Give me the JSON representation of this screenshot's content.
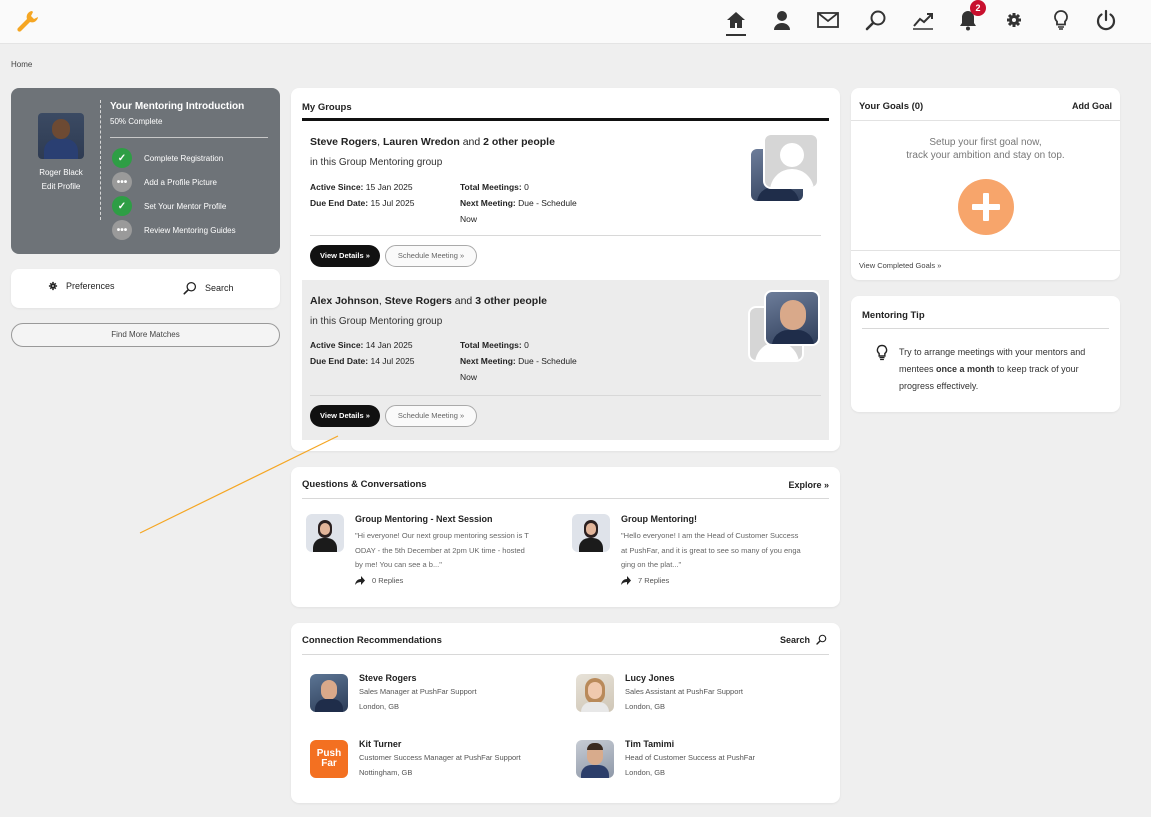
{
  "topbar": {
    "badge_count": "2",
    "icons": [
      "wrench-icon",
      "home-icon",
      "profile-icon",
      "mail-icon",
      "search-icon",
      "analytics-icon",
      "bell-icon",
      "gear-icon",
      "lightbulb-icon",
      "power-icon"
    ]
  },
  "breadcrumb": "Home",
  "intro": {
    "title": "Your Mentoring Introduction",
    "progress": "50% Complete",
    "progress_value": 0.5,
    "user_name": "Roger Black",
    "edit_profile": "Edit Profile",
    "steps": [
      {
        "label": "Complete Registration",
        "done": true
      },
      {
        "label": "Add a Profile Picture",
        "done": false
      },
      {
        "label": "Set Your Mentor Profile",
        "done": true
      },
      {
        "label": "Review Mentoring Guides",
        "done": false
      }
    ]
  },
  "preferences": {
    "label": "Preferences"
  },
  "search": {
    "label": "Search"
  },
  "find_more": "Find More Matches",
  "groups": {
    "title": "My Groups",
    "items": [
      {
        "people_a": "Steve Rogers",
        "sep": ", ",
        "people_b": "Lauren Wredon",
        "and": " and ",
        "others": "2 other people",
        "sub": "in this Group Mentoring group",
        "active_label": "Active Since:",
        "active_value": "15 Jan 2025",
        "due_label": "Due End Date:",
        "due_value": "15 Jul 2025",
        "total_label": "Total Meetings:",
        "total_value": "0",
        "next_label": "Next Meeting:",
        "next_value": "Due - Schedule",
        "next_value2": "Now",
        "view_details": "View Details »",
        "schedule": "Schedule Meeting »"
      },
      {
        "people_a": "Alex Johnson",
        "sep": ", ",
        "people_b": "Steve Rogers",
        "and": " and ",
        "others": "3 other people",
        "sub": "in this Group Mentoring group",
        "active_label": "Active Since:",
        "active_value": "14 Jan 2025",
        "due_label": "Due End Date:",
        "due_value": "14 Jul 2025",
        "total_label": "Total Meetings:",
        "total_value": "0",
        "next_label": "Next Meeting:",
        "next_value": "Due - Schedule",
        "next_value2": "Now",
        "view_details": "View Details »",
        "schedule": "Schedule Meeting »"
      }
    ]
  },
  "questions": {
    "title": "Questions & Conversations",
    "explore": "Explore »",
    "posts": [
      {
        "title": "Group Mentoring - Next Session",
        "line1": "\"Hi everyone! Our next group mentoring session is T",
        "line2": "ODAY - the 5th December at 2pm UK time - hosted",
        "line3": "by me! You can see a b...\"",
        "replies": "0 Replies"
      },
      {
        "title": "Group Mentoring!",
        "line1": "\"Hello everyone! I am the Head of Customer Success",
        "line2": "at PushFar, and it is great to see so many of you enga",
        "line3": "ging on the plat...\"",
        "replies": "7 Replies"
      }
    ]
  },
  "recommendations": {
    "title": "Connection Recommendations",
    "search": "Search",
    "people": [
      {
        "name": "Steve Rogers",
        "role": "Sales Manager at PushFar Support",
        "location": "London, GB"
      },
      {
        "name": "Lucy Jones",
        "role": "Sales Assistant at PushFar Support",
        "location": "London, GB"
      },
      {
        "name": "Kit Turner",
        "role": "Customer Success Manager at PushFar Support",
        "location": "Nottingham, GB",
        "logo_text": "Push Far"
      },
      {
        "name": "Tim Tamimi",
        "role": "Head of Customer Success at PushFar",
        "location": "London, GB"
      }
    ]
  },
  "goals": {
    "title": "Your Goals (0)",
    "add": "Add Goal",
    "empty_line1": "Setup your first goal now,",
    "empty_line2": "track your ambition and stay on top.",
    "view_completed": "View Completed Goals »"
  },
  "tip": {
    "title": "Mentoring Tip",
    "pre": "Try to arrange meetings with your mentors and mentees ",
    "bold": "once a month",
    "post": " to keep track of your progress effectively."
  },
  "colors": {
    "accent_orange": "#f7a56b",
    "logo_orange": "#f5a623",
    "badge_red": "#c8102e",
    "done_green": "#2e9e45"
  }
}
